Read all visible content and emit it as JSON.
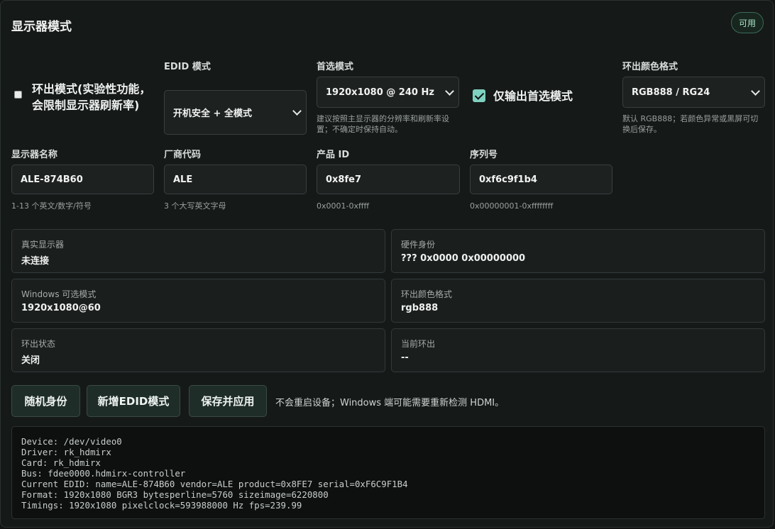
{
  "header": {
    "title": "显示器模式",
    "status_badge": "可用"
  },
  "loop_mode": {
    "label": "环出模式(实验性功能，会限制显示器刷新率)",
    "checked": false
  },
  "edid_mode": {
    "label": "EDID 模式",
    "value": "开机安全 + 全模式"
  },
  "preferred_mode": {
    "label": "首选模式",
    "value": "1920x1080 @ 240 Hz",
    "hint": "建议按照主显示器的分辨率和刷新率设置；不确定时保持自动。"
  },
  "only_preferred": {
    "label": "仅输出首选模式",
    "checked": true
  },
  "color_format": {
    "label": "环出颜色格式",
    "value": "RGB888 / RG24",
    "hint": "默认 RGB888；若颜色异常或黑屏可切换后保存。"
  },
  "display_name": {
    "label": "显示器名称",
    "value": "ALE-874B60",
    "hint": "1-13 个英文/数字/符号"
  },
  "vendor_code": {
    "label": "厂商代码",
    "value": "ALE",
    "hint": "3 个大写英文字母"
  },
  "product_id": {
    "label": "产品 ID",
    "value": "0x8fe7",
    "hint": "0x0001-0xffff"
  },
  "serial": {
    "label": "序列号",
    "value": "0xf6c9f1b4",
    "hint": "0x00000001-0xffffffff"
  },
  "info": {
    "real_display": {
      "key": "真实显示器",
      "value": "未连接"
    },
    "hardware_id": {
      "key": "硬件身份",
      "value": "??? 0x0000 0x00000000"
    },
    "windows_modes": {
      "key": "Windows 可选模式",
      "value": "1920x1080@60"
    },
    "loop_color": {
      "key": "环出颜色格式",
      "value": "rgb888"
    },
    "loop_state": {
      "key": "环出状态",
      "value": "关闭"
    },
    "current_loop": {
      "key": "当前环出",
      "value": "--"
    }
  },
  "actions": {
    "random_identity": "随机身份",
    "add_edid_mode": "新增EDID模式",
    "save_apply": "保存并应用",
    "note": "不会重启设备；Windows 端可能需要重新检测 HDMI。"
  },
  "console": [
    "Device: /dev/video0",
    "Driver: rk_hdmirx",
    "Card: rk_hdmirx",
    "Bus: fdee0000.hdmirx-controller",
    "Current EDID: name=ALE-874B60 vendor=ALE product=0x8FE7 serial=0xF6C9F1B4",
    "Format: 1920x1080 BGR3 bytesperline=5760 sizeimage=6220800",
    "Timings: 1920x1080 pixelclock=593988000 Hz fps=239.99"
  ]
}
